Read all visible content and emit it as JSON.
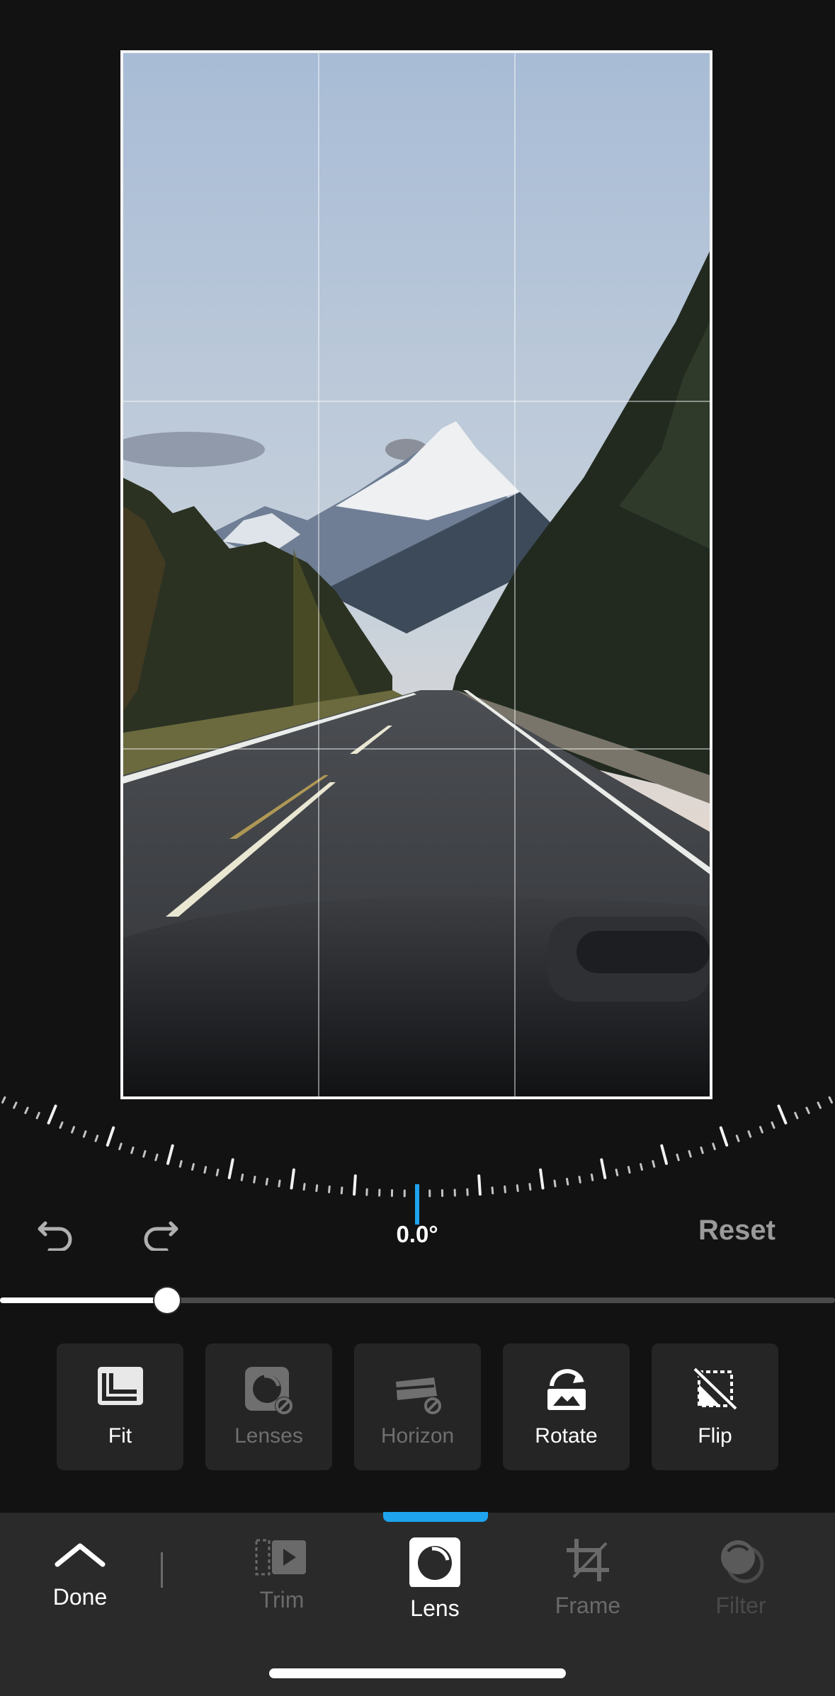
{
  "editor": {
    "angle_value": "0.0°",
    "reset_label": "Reset"
  },
  "zoom_slider": {
    "value_fraction": 0.2
  },
  "tools": [
    {
      "label": "Fit",
      "icon": "fit-icon",
      "enabled": true
    },
    {
      "label": "Lenses",
      "icon": "lenses-icon",
      "enabled": false
    },
    {
      "label": "Horizon",
      "icon": "horizon-icon",
      "enabled": false
    },
    {
      "label": "Rotate",
      "icon": "rotate-icon",
      "enabled": true
    },
    {
      "label": "Flip",
      "icon": "flip-icon",
      "enabled": true
    }
  ],
  "nav": {
    "done_label": "Done",
    "items": [
      {
        "label": "Trim",
        "icon": "trim-icon",
        "active": false
      },
      {
        "label": "Lens",
        "icon": "lens-icon",
        "active": true
      },
      {
        "label": "Frame",
        "icon": "frame-icon",
        "active": false
      },
      {
        "label": "Filter",
        "icon": "filter-icon",
        "active": false
      }
    ]
  },
  "colors": {
    "background": "#121213",
    "accent": "#1ea3ee",
    "tile": "#252526",
    "nav_bar": "#2a2a2b"
  }
}
